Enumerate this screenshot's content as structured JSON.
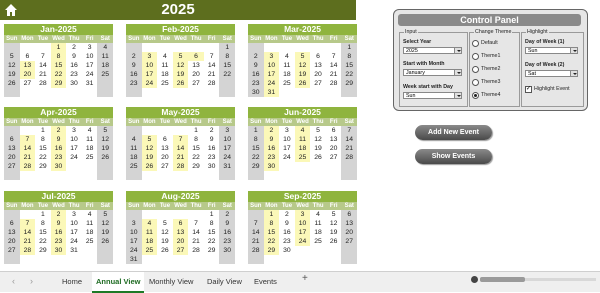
{
  "calendar": {
    "year": "2025",
    "dow": [
      "Sun",
      "Mon",
      "Tue",
      "Wed",
      "Thu",
      "Fri",
      "Sat"
    ],
    "months": [
      {
        "title": "Jan-2025",
        "offset": 3,
        "days": 31,
        "hl": [
          1,
          8,
          13,
          15,
          20,
          22,
          29
        ]
      },
      {
        "title": "Feb-2025",
        "offset": 6,
        "days": 28,
        "hl": [
          3,
          5,
          6,
          10,
          12,
          17,
          19,
          24,
          26
        ]
      },
      {
        "title": "Mar-2025",
        "offset": 6,
        "days": 31,
        "hl": [
          3,
          5,
          10,
          12,
          17,
          19,
          24,
          26,
          31
        ]
      },
      {
        "title": "Apr-2025",
        "offset": 2,
        "days": 30,
        "hl": [
          2,
          7,
          9,
          14,
          16,
          21,
          23,
          28,
          30
        ]
      },
      {
        "title": "May-2025",
        "offset": 4,
        "days": 31,
        "hl": [
          5,
          7,
          12,
          14,
          19,
          21,
          26,
          28
        ]
      },
      {
        "title": "Jun-2025",
        "offset": 0,
        "days": 30,
        "hl": [
          2,
          4,
          9,
          11,
          16,
          18,
          23,
          25,
          30
        ]
      },
      {
        "title": "Jul-2025",
        "offset": 2,
        "days": 31,
        "hl": [
          2,
          7,
          9,
          14,
          16,
          21,
          23,
          28,
          30
        ]
      },
      {
        "title": "Aug-2025",
        "offset": 5,
        "days": 31,
        "hl": [
          4,
          6,
          11,
          13,
          18,
          20,
          25,
          27
        ]
      },
      {
        "title": "Sep-2025",
        "offset": 1,
        "days": 30,
        "hl": [
          1,
          3,
          8,
          10,
          15,
          17,
          22,
          24,
          29
        ]
      }
    ]
  },
  "control_panel": {
    "title": "Control Panel",
    "input": {
      "group_title": "Input",
      "select_year_label": "Select Year",
      "select_year_value": "2025",
      "start_month_label": "Start with Month",
      "start_month_value": "January",
      "week_start_label": "Week start with Day",
      "week_start_value": "Sun"
    },
    "theme": {
      "group_title": "Change Theme",
      "options": [
        "Default",
        "Theme1",
        "Theme2",
        "Theme3",
        "Theme4"
      ],
      "selected": "Theme4"
    },
    "highlight": {
      "group_title": "Highlight",
      "dow1_label": "Day of Week (1)",
      "dow1_value": "Sun",
      "dow2_label": "Day of Week (2)",
      "dow2_value": "Sat",
      "event_label": "Highlight Event",
      "event_checked": true
    }
  },
  "buttons": {
    "add_event": "Add New Event",
    "show_events": "Show Events"
  },
  "tabs": [
    "Home",
    "Annual View",
    "Monthly View",
    "Daily View",
    "Events"
  ],
  "active_tab": "Annual View",
  "add_sheet_symbol": "+",
  "nav": {
    "prev": "‹",
    "next": "›"
  }
}
